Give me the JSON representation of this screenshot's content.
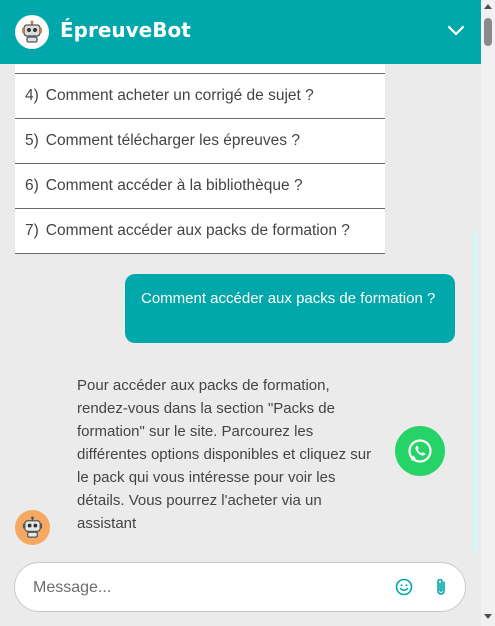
{
  "header": {
    "title": "ÉpreuveBot",
    "icons": {
      "logo": "robot-icon",
      "collapse": "chevron-down-icon"
    }
  },
  "options": [
    {
      "num": "4)",
      "label": "Comment acheter un corrigé de sujet ?"
    },
    {
      "num": "5)",
      "label": "Comment télécharger les épreuves ?"
    },
    {
      "num": "6)",
      "label": "Comment accéder à la bibliothèque ?"
    },
    {
      "num": "7)",
      "label": "Comment accéder aux packs de formation ?"
    }
  ],
  "messages": {
    "user": "Comment accéder aux packs de formation ?",
    "bot": "Pour accéder aux packs de formation, rendez-vous dans la section \"Packs de formation\" sur le site. Parcourez les différentes options disponibles et cliquez sur le pack qui vous intéresse pour voir les détails. Vous pourrez l'acheter via un assistant"
  },
  "composer": {
    "placeholder": "Message...",
    "icons": {
      "emoji": "smiley-icon",
      "attach": "paperclip-icon",
      "whatsapp": "whatsapp-icon"
    }
  },
  "colors": {
    "accent": "#00a8ab",
    "user_bubble_text": "#ffffff",
    "whatsapp": "#25d366",
    "avatar": "#f5a862",
    "background": "#ebebeb"
  }
}
